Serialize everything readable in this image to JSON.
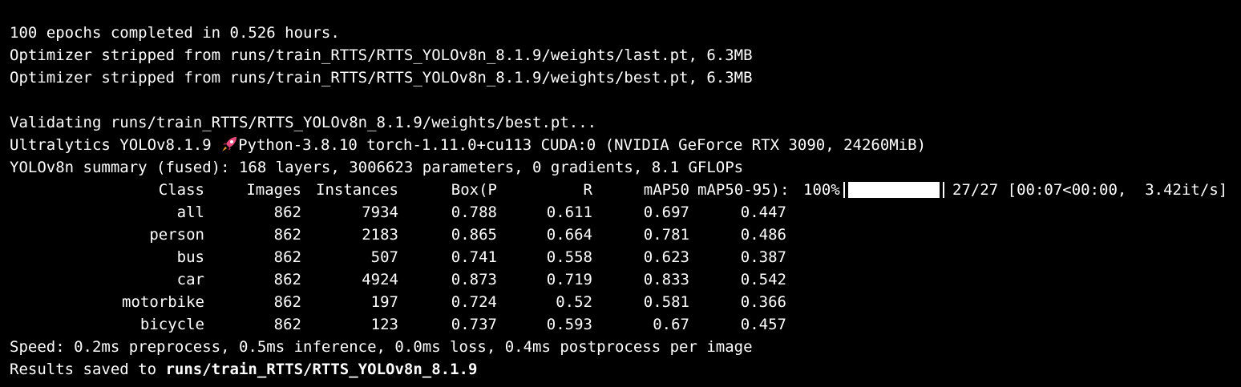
{
  "colors": {
    "background": "#000000",
    "foreground": "#ffffff",
    "rocket": "#e8487a"
  },
  "lines": {
    "epochs": "100 epochs completed in 0.526 hours.",
    "strip_last": "Optimizer stripped from runs/train_RTTS/RTTS_YOLOv8n_8.1.9/weights/last.pt, 6.3MB",
    "strip_best": "Optimizer stripped from runs/train_RTTS/RTTS_YOLOv8n_8.1.9/weights/best.pt, 6.3MB",
    "validating": "Validating runs/train_RTTS/RTTS_YOLOv8n_8.1.9/weights/best.pt...",
    "version_prefix": "Ultralytics YOLOv8.1.9 ",
    "version_icon": "rocket-icon",
    "version_suffix": "Python-3.8.10 torch-1.11.0+cu113 CUDA:0 (NVIDIA GeForce RTX 3090, 24260MiB)",
    "summary": "YOLOv8n summary (fused): 168 layers, 3006623 parameters, 0 gradients, 8.1 GFLOPs",
    "speed": "Speed: 0.2ms preprocess, 0.5ms inference, 0.0ms loss, 0.4ms postprocess per image",
    "results_prefix": "Results saved to ",
    "results_path": "runs/train_RTTS/RTTS_YOLOv8n_8.1.9"
  },
  "table": {
    "headers": [
      "Class",
      "Images",
      "Instances",
      "Box(P",
      "R",
      "mAP50",
      "mAP50-95):"
    ],
    "progress": {
      "percent_label": "100%",
      "fraction": 1.0,
      "count": "27/27",
      "timing": "[00:07<00:00,  3.42it/s]"
    },
    "rows": [
      [
        "all",
        "862",
        "7934",
        "0.788",
        "0.611",
        "0.697",
        "0.447"
      ],
      [
        "person",
        "862",
        "2183",
        "0.865",
        "0.664",
        "0.781",
        "0.486"
      ],
      [
        "bus",
        "862",
        "507",
        "0.741",
        "0.558",
        "0.623",
        "0.387"
      ],
      [
        "car",
        "862",
        "4924",
        "0.873",
        "0.719",
        "0.833",
        "0.542"
      ],
      [
        "motorbike",
        "862",
        "197",
        "0.724",
        "0.52",
        "0.581",
        "0.366"
      ],
      [
        "bicycle",
        "862",
        "123",
        "0.737",
        "0.593",
        "0.67",
        "0.457"
      ]
    ]
  }
}
